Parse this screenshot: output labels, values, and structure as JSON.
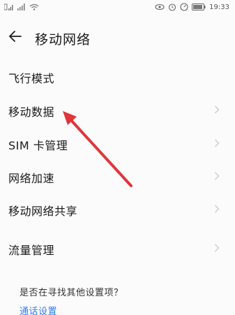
{
  "status_bar": {
    "time": "19:33",
    "left_icons": [
      "sim-signal-icon",
      "wifi-icon"
    ],
    "right_icons": [
      "eye-comfort-icon",
      "alarm-icon",
      "speed-icon",
      "battery-icon"
    ]
  },
  "header": {
    "back_icon": "arrow-left-icon",
    "title": "移动网络"
  },
  "menu": {
    "items": [
      {
        "label": "飞行模式",
        "chevron": false
      },
      {
        "label": "移动数据",
        "chevron": true
      },
      {
        "label": "SIM 卡管理",
        "chevron": true
      },
      {
        "label": "网络加速",
        "chevron": true
      },
      {
        "label": "移动网络共享",
        "chevron": true
      },
      {
        "label": "流量管理",
        "chevron": true
      }
    ]
  },
  "footer": {
    "question": "是否在寻找其他设置项？",
    "link": "通话设置"
  },
  "annotation": {
    "color": "#e0353a",
    "points_to": "移动数据"
  },
  "colors": {
    "link": "#2f7df6",
    "text": "#1a1a1a",
    "chevron": "#c8c8c8"
  }
}
